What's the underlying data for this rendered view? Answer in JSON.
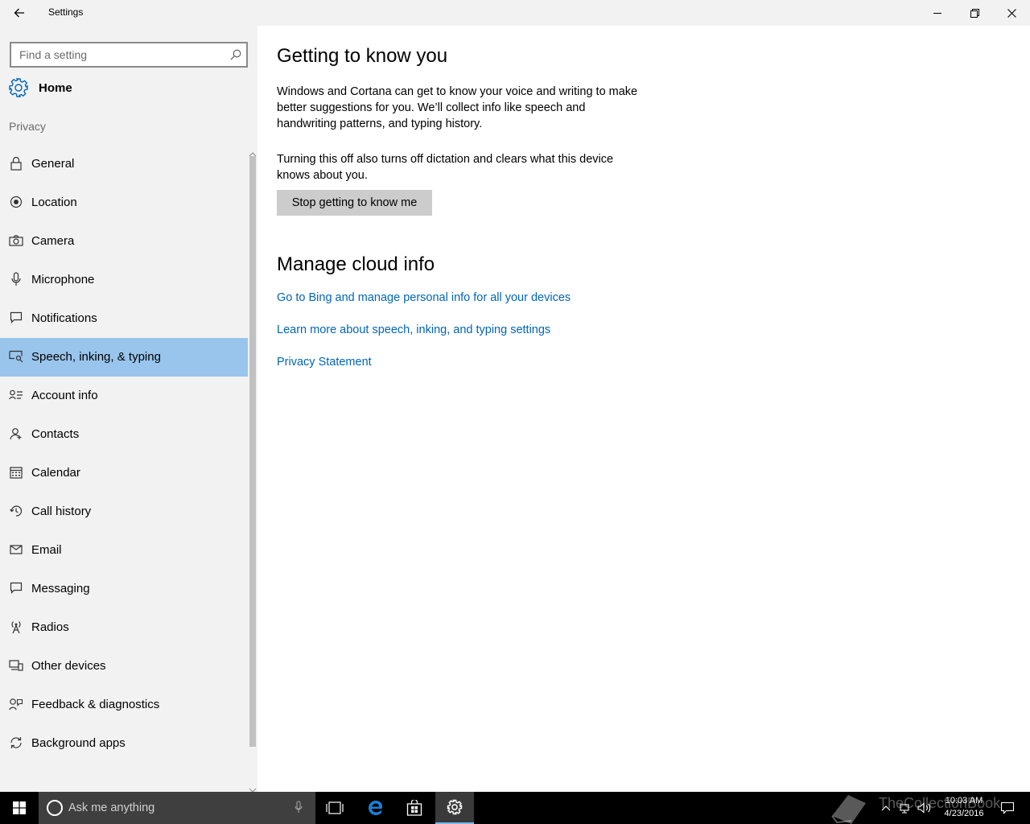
{
  "window": {
    "title": "Settings",
    "back_icon": "back-arrow-icon",
    "controls": [
      "minimize-icon",
      "restore-icon",
      "close-icon"
    ]
  },
  "sidebar": {
    "search_placeholder": "Find a setting",
    "home_label": "Home",
    "section_label": "Privacy",
    "items": [
      {
        "label": "General",
        "icon": "lock-icon"
      },
      {
        "label": "Location",
        "icon": "location-icon"
      },
      {
        "label": "Camera",
        "icon": "camera-icon"
      },
      {
        "label": "Microphone",
        "icon": "microphone-icon"
      },
      {
        "label": "Notifications",
        "icon": "notifications-icon"
      },
      {
        "label": "Speech, inking, & typing",
        "icon": "speech-inking-icon",
        "selected": true
      },
      {
        "label": "Account info",
        "icon": "account-info-icon"
      },
      {
        "label": "Contacts",
        "icon": "contacts-icon"
      },
      {
        "label": "Calendar",
        "icon": "calendar-icon"
      },
      {
        "label": "Call history",
        "icon": "call-history-icon"
      },
      {
        "label": "Email",
        "icon": "email-icon"
      },
      {
        "label": "Messaging",
        "icon": "messaging-icon"
      },
      {
        "label": "Radios",
        "icon": "radios-icon"
      },
      {
        "label": "Other devices",
        "icon": "other-devices-icon"
      },
      {
        "label": "Feedback & diagnostics",
        "icon": "feedback-icon"
      },
      {
        "label": "Background apps",
        "icon": "background-apps-icon"
      }
    ]
  },
  "main": {
    "heading1": "Getting to know you",
    "paragraph1": "Windows and Cortana can get to know your voice and writing to make better suggestions for you. We’ll collect info like speech and handwriting patterns, and typing history.",
    "paragraph2": "Turning this off also turns off dictation and clears what this device knows about you.",
    "button_label": "Stop getting to know me",
    "heading2": "Manage cloud info",
    "links": [
      "Go to Bing and manage personal info for all your devices",
      "Learn more about speech, inking, and typing settings",
      "Privacy Statement"
    ]
  },
  "taskbar": {
    "search_placeholder": "Ask me anything",
    "time": "10:03 AM",
    "date": "4/23/2016",
    "watermark": "TheCollectionBook"
  },
  "colors": {
    "accent": "#0066b4",
    "selected_bg": "#99c5ec",
    "sidebar_bg": "#f2f2f2",
    "button_bg": "#cccccc"
  }
}
